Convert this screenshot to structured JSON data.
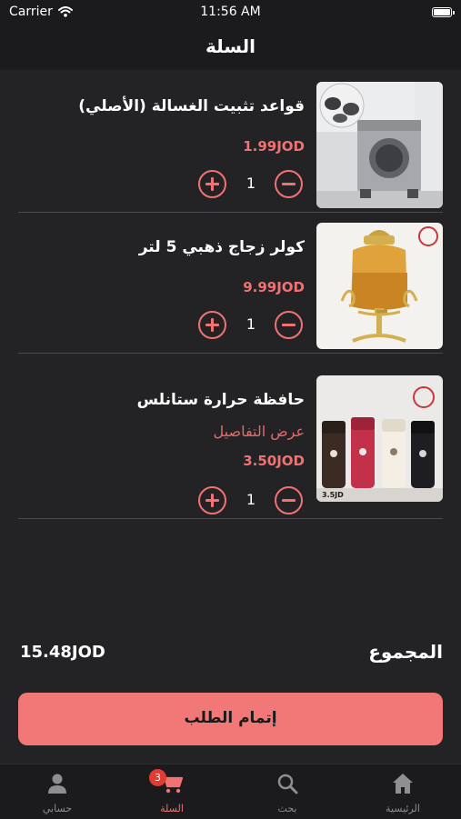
{
  "status_bar": {
    "carrier": "Carrier",
    "time": "11:56 AM"
  },
  "header": {
    "title": "السلة"
  },
  "cart": {
    "items": [
      {
        "name": "قواعد تثبيت الغسالة (الأصلي)",
        "price": "1.99JOD",
        "quantity": "1",
        "details_link": null
      },
      {
        "name": "كولر زجاج ذهبي 5 لتر",
        "price": "9.99JOD",
        "quantity": "1",
        "details_link": null
      },
      {
        "name": "حافظة حرارة ستانلس",
        "price": "3.50JOD",
        "quantity": "1",
        "details_link": "عرض التفاصيل",
        "image_price_tag": "3.5JD"
      }
    ]
  },
  "summary": {
    "total_label": "المجموع",
    "total_value": "15.48JOD"
  },
  "checkout": {
    "label": "إتمام الطلب"
  },
  "tab_bar": {
    "tabs": [
      {
        "label": "الرئيسية",
        "icon": "home-icon"
      },
      {
        "label": "بحث",
        "icon": "search-icon"
      },
      {
        "label": "السلة",
        "icon": "cart-icon",
        "badge": "3",
        "active": true
      },
      {
        "label": "حسابي",
        "icon": "person-icon"
      }
    ]
  },
  "colors": {
    "accent": "#f27777",
    "background": "#232325",
    "bar": "#1b1b1d",
    "badge": "#e33b33"
  }
}
